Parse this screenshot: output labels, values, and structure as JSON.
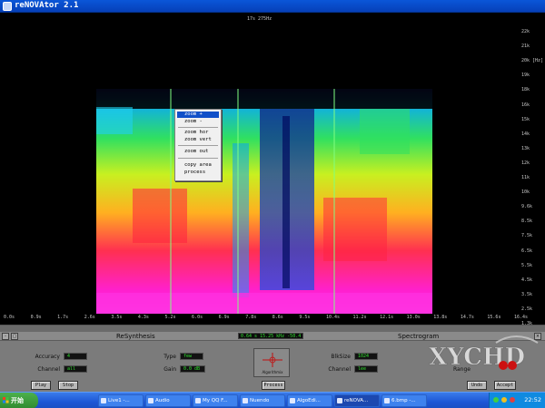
{
  "window": {
    "title": "reNOVAtor 2.1"
  },
  "spectrogram": {
    "top_readout": "17s 275Hz",
    "freq_ticks": [
      "22k",
      "21k",
      "20k [Hz]",
      "19k",
      "18k",
      "16k",
      "15k",
      "14k",
      "13k",
      "12k",
      "11k",
      "10k",
      "9.6k",
      "8.5k",
      "7.5k",
      "6.5k",
      "5.5k",
      "4.5k",
      "3.5k",
      "2.5k",
      "1.3k"
    ],
    "time_ticks": [
      "0.0s",
      "0.9s",
      "1.7s",
      "2.6s",
      "3.5s",
      "4.3s",
      "5.2s",
      "6.0s",
      "6.9s",
      "7.8s",
      "8.6s",
      "9.5s",
      "10.4s",
      "11.2s",
      "12.1s",
      "13.0s",
      "13.8s",
      "14.7s",
      "15.6s",
      "16.4s"
    ]
  },
  "context_menu": {
    "items": [
      "zoom +",
      "zoom -",
      "zoom hor",
      "zoom vert",
      "zoom out",
      "copy area",
      "process"
    ],
    "selected": 0
  },
  "panel": {
    "resynthesis": {
      "heading": "ReSynthesis",
      "accuracy_label": "Accuracy",
      "accuracy_value": "4",
      "channel_label": "Channel",
      "channel_value": "all",
      "type_label": "Type",
      "type_value": "few",
      "gain_label": "Gain",
      "gain_value": "0.0 dB"
    },
    "readout": "0.64 s    15.25 kHz    -50.4 dB",
    "logo": "Algorithmix",
    "spectrogram": {
      "heading": "Spectrogram",
      "blksize_label": "BlkSize",
      "blksize_value": "1024",
      "channel_label": "Channel",
      "channel_value": "lee",
      "range_label": "Range"
    },
    "buttons": {
      "play": "Play",
      "stop": "Stop",
      "process": "Process",
      "undo": "Undo",
      "accept": "Accept"
    },
    "watermark": "XYCHD"
  },
  "taskbar": {
    "start": "开始",
    "tasks": [
      "Live1 -...",
      "Audio",
      "My QQ F...",
      "Nuendo",
      "AlgoEdi...",
      "reNOVA...",
      "6.bmp -..."
    ],
    "active": 5,
    "clock": "22:52"
  },
  "colors": {
    "titlebar": "#0a56d8",
    "panel": "#7b7b7b",
    "lcd_text": "#30e030",
    "menu_highlight": "#1050c8",
    "taskbar": "#1d57d6",
    "watermark": "#d8d8d8",
    "watermark_accent": "#cc1010"
  }
}
